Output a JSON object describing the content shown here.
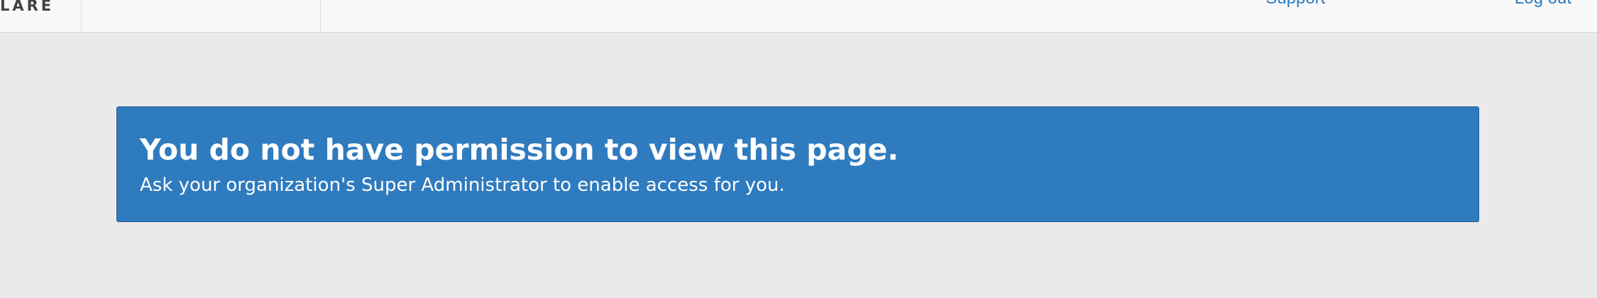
{
  "header": {
    "logo_text": "LARE",
    "nav": {
      "support_label": "Support",
      "account_label": "Log out"
    }
  },
  "alert": {
    "title": "You do not have permission to view this page.",
    "message": "Ask your organization's Super Administrator to enable access for you."
  },
  "colors": {
    "page_background": "#eaeaea",
    "header_background": "#f9f9f9",
    "alert_background": "#2f7bbf",
    "link": "#2f7bbf"
  }
}
